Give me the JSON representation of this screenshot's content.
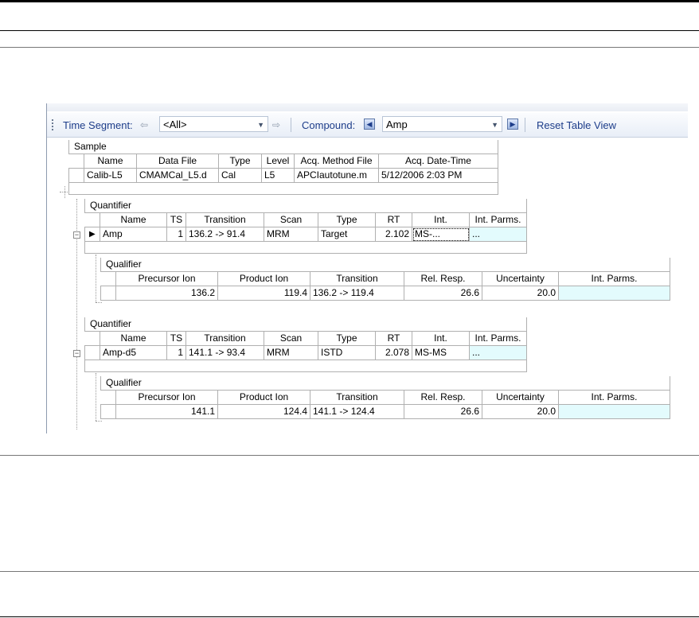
{
  "toolbar": {
    "time_segment_label": "Time Segment:",
    "time_segment_value": "<All>",
    "compound_label": "Compound:",
    "compound_value": "Amp",
    "reset_label": "Reset Table View",
    "prev_icon": "left-arrow-icon",
    "next_icon": "right-arrow-icon"
  },
  "sample": {
    "band": "Sample",
    "headers": [
      "Name",
      "Data File",
      "Type",
      "Level",
      "Acq. Method File",
      "Acq. Date-Time"
    ],
    "row": [
      "Calib-L5",
      "CMAMCal_L5.d",
      "Cal",
      "L5",
      "APCIautotune.m",
      "5/12/2006 2:03 PM"
    ]
  },
  "quantifiers": [
    {
      "band": "Quantifier",
      "headers": [
        "Name",
        "TS",
        "Transition",
        "Scan",
        "Type",
        "RT",
        "Int.",
        "Int. Parms."
      ],
      "row": [
        "Amp",
        "1",
        "136.2 -> 91.4",
        "MRM",
        "Target",
        "2.102",
        "MS-...",
        "..."
      ],
      "qualifier": {
        "band": "Qualifier",
        "headers": [
          "Precursor Ion",
          "Product Ion",
          "Transition",
          "Rel. Resp.",
          "Uncertainty",
          "Int. Parms."
        ],
        "row": [
          "136.2",
          "119.4",
          "136.2 -> 119.4",
          "26.6",
          "20.0",
          ""
        ]
      }
    },
    {
      "band": "Quantifier",
      "headers": [
        "Name",
        "TS",
        "Transition",
        "Scan",
        "Type",
        "RT",
        "Int.",
        "Int. Parms."
      ],
      "row": [
        "Amp-d5",
        "1",
        "141.1 -> 93.4",
        "MRM",
        "ISTD",
        "2.078",
        "MS-MS",
        "..."
      ],
      "qualifier": {
        "band": "Qualifier",
        "headers": [
          "Precursor Ion",
          "Product Ion",
          "Transition",
          "Rel. Resp.",
          "Uncertainty",
          "Int. Parms."
        ],
        "row": [
          "141.1",
          "124.4",
          "141.1 -> 124.4",
          "26.6",
          "20.0",
          ""
        ]
      }
    }
  ],
  "colors": {
    "toolbar_text": "#1d3d8a",
    "param_cell": "#e3fbfd"
  }
}
